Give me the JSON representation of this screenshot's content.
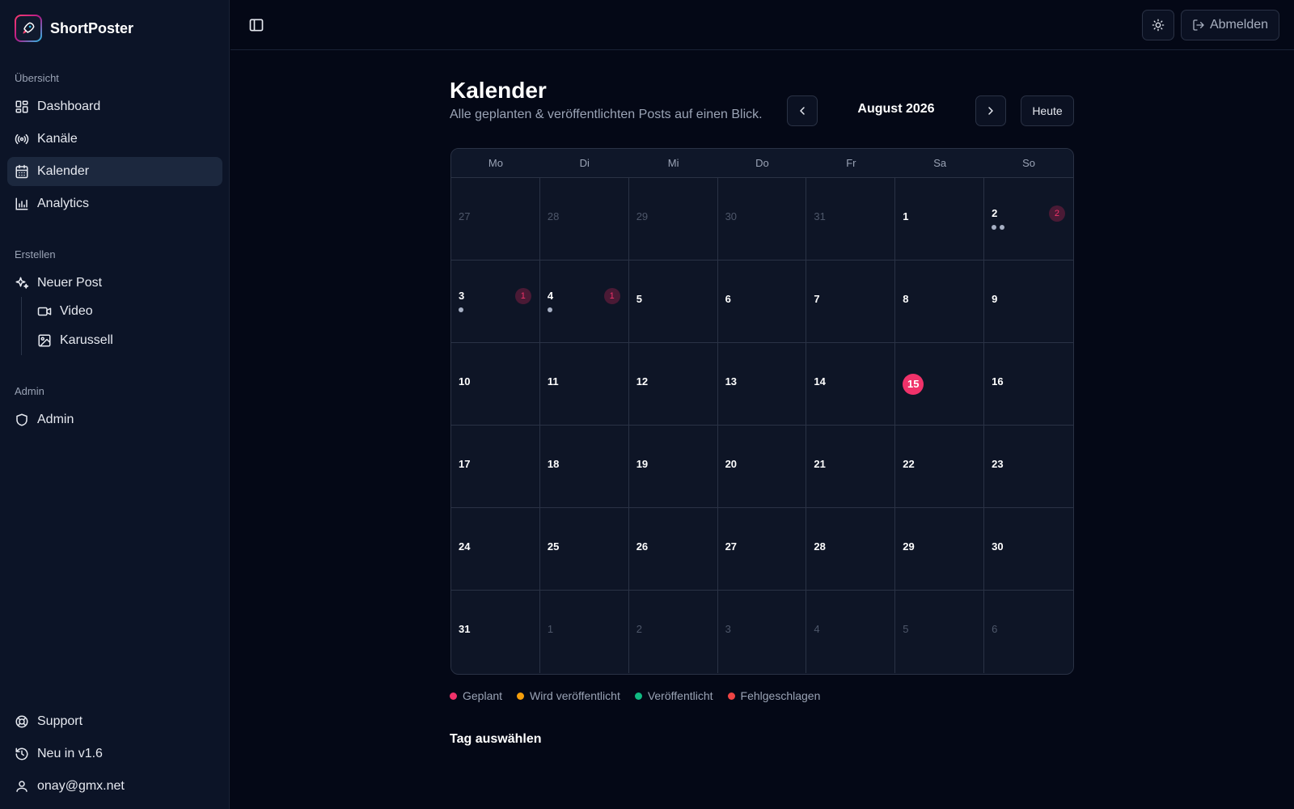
{
  "brand": {
    "name": "ShortPoster"
  },
  "sidebar": {
    "sections": {
      "overview": "Übersicht",
      "create": "Erstellen",
      "admin": "Admin"
    },
    "items": {
      "dashboard": "Dashboard",
      "channels": "Kanäle",
      "calendar": "Kalender",
      "analytics": "Analytics",
      "new_post": "Neuer Post",
      "video": "Video",
      "carousel": "Karussell",
      "admin": "Admin",
      "support": "Support",
      "new_in": "Neu in v1.6",
      "user": "onay@gmx.net"
    },
    "active_item": "calendar"
  },
  "topbar": {
    "logout_label": "Abmelden"
  },
  "calendar": {
    "title": "Kalender",
    "subtitle": "Alle geplanten & veröffentlichten Posts auf einen Blick.",
    "month": "August 2026",
    "today_label": "Heute",
    "weekdays": [
      "Mo",
      "Di",
      "Mi",
      "Do",
      "Fr",
      "Sa",
      "So"
    ],
    "days": [
      {
        "n": "27",
        "outside": true
      },
      {
        "n": "28",
        "outside": true
      },
      {
        "n": "29",
        "outside": true
      },
      {
        "n": "30",
        "outside": true
      },
      {
        "n": "31",
        "outside": true
      },
      {
        "n": "1"
      },
      {
        "n": "2",
        "posts": 2,
        "badge": "2"
      },
      {
        "n": "3",
        "posts": 1,
        "badge": "1"
      },
      {
        "n": "4",
        "posts": 1,
        "badge": "1"
      },
      {
        "n": "5"
      },
      {
        "n": "6"
      },
      {
        "n": "7"
      },
      {
        "n": "8"
      },
      {
        "n": "9"
      },
      {
        "n": "10"
      },
      {
        "n": "11"
      },
      {
        "n": "12"
      },
      {
        "n": "13"
      },
      {
        "n": "14"
      },
      {
        "n": "15",
        "today": true
      },
      {
        "n": "16"
      },
      {
        "n": "17"
      },
      {
        "n": "18"
      },
      {
        "n": "19"
      },
      {
        "n": "20"
      },
      {
        "n": "21"
      },
      {
        "n": "22"
      },
      {
        "n": "23"
      },
      {
        "n": "24"
      },
      {
        "n": "25"
      },
      {
        "n": "26"
      },
      {
        "n": "27"
      },
      {
        "n": "28"
      },
      {
        "n": "29"
      },
      {
        "n": "30"
      },
      {
        "n": "31"
      },
      {
        "n": "1",
        "outside": true
      },
      {
        "n": "2",
        "outside": true
      },
      {
        "n": "3",
        "outside": true
      },
      {
        "n": "4",
        "outside": true
      },
      {
        "n": "5",
        "outside": true
      },
      {
        "n": "6",
        "outside": true
      }
    ]
  },
  "legend": [
    {
      "label": "Geplant",
      "color": "#f0326a"
    },
    {
      "label": "Wird veröffentlicht",
      "color": "#f59e0b"
    },
    {
      "label": "Veröffentlicht",
      "color": "#10b981"
    },
    {
      "label": "Fehlgeschlagen",
      "color": "#ef4444"
    }
  ],
  "detail": {
    "heading": "Tag auswählen"
  },
  "colors": {
    "accent": "#f0326a",
    "background": "#040816",
    "sidebar": "#0c1427"
  }
}
